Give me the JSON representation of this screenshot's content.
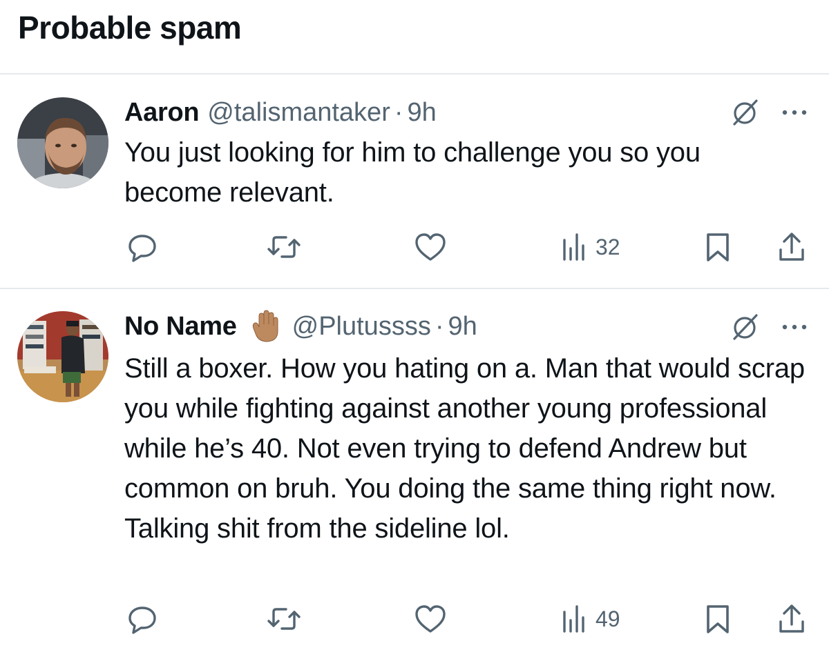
{
  "section": {
    "title": "Probable spam"
  },
  "tweets": [
    {
      "display_name": "Aaron",
      "handle": "@talismantaker",
      "separator": "·",
      "time": "9h",
      "text": "You just looking for him to challenge you so you become relevant.",
      "views": "32"
    },
    {
      "display_name": "No Name",
      "emoji": "raised-hand-emoji",
      "handle": "@Plutussss",
      "separator": "·",
      "time": "9h",
      "text": "Still a boxer. How you hating on a. Man that would scrap you while fighting against another young professional while he’s 40. Not even trying to defend Andrew but common on bruh. You doing the same thing right now. Talking shit from the sideline lol.",
      "views": "49"
    }
  ],
  "icons": {
    "reply": "reply-icon",
    "retweet": "retweet-icon",
    "like": "like-icon",
    "views": "views-icon",
    "bookmark": "bookmark-icon",
    "share": "share-icon",
    "grok": "grok-icon",
    "more": "more-icon"
  },
  "colors": {
    "text_primary": "#0f1419",
    "text_secondary": "#536471",
    "divider": "#e6e9ec",
    "icon": "#536471"
  }
}
